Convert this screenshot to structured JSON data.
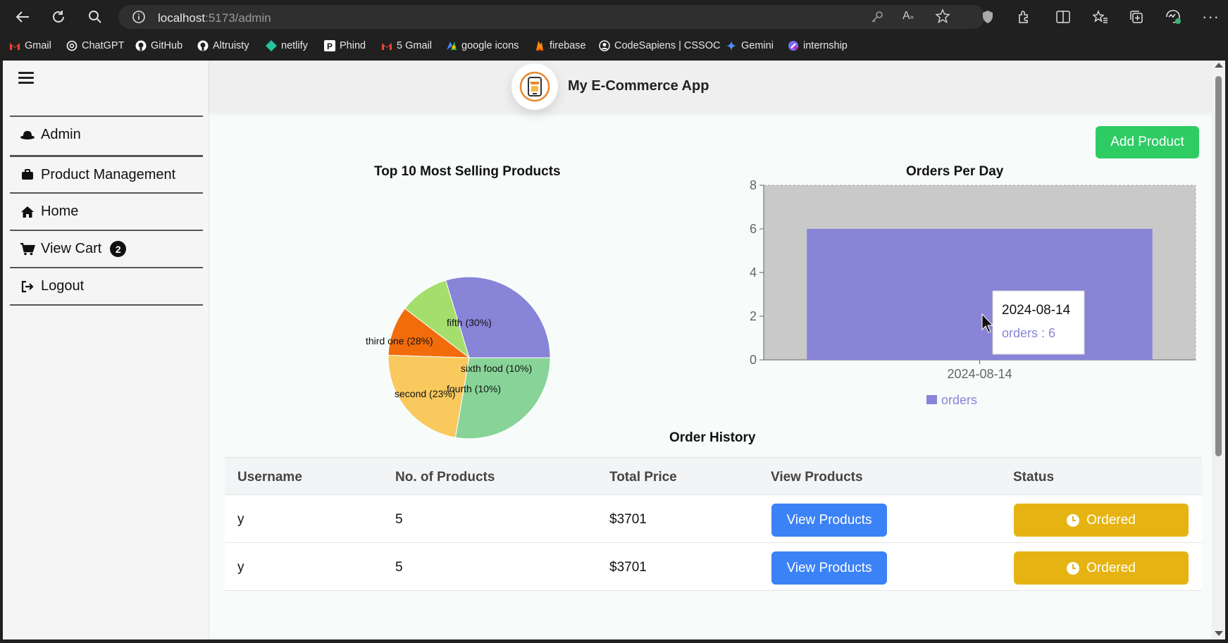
{
  "browser": {
    "url_host": "localhost",
    "url_path": ":5173/admin",
    "bookmarks": [
      {
        "label": "Gmail",
        "icon": "gmail-icon",
        "color": "#ea4335"
      },
      {
        "label": "ChatGPT",
        "icon": "chatgpt-icon",
        "color": "#ffffff"
      },
      {
        "label": "GitHub",
        "icon": "github-icon",
        "color": "#ffffff"
      },
      {
        "label": "Altruisty",
        "icon": "github-icon",
        "color": "#ffffff"
      },
      {
        "label": "netlify",
        "icon": "netlify-icon",
        "color": "#25c2a0"
      },
      {
        "label": "Phind",
        "icon": "phind-icon",
        "color": "#ffffff"
      },
      {
        "label": "5 Gmail",
        "icon": "gmail-icon",
        "color": "#ea4335"
      },
      {
        "label": "google icons",
        "icon": "google-icons-icon",
        "color": "#4285f4"
      },
      {
        "label": "firebase",
        "icon": "firebase-icon",
        "color": "#ff8a00"
      },
      {
        "label": "CodeSapiens | CSSOC",
        "icon": "codesapiens-icon",
        "color": "#ffffff"
      },
      {
        "label": "Gemini",
        "icon": "gemini-icon",
        "color": "#4f8df7"
      },
      {
        "label": "internship",
        "icon": "internship-icon",
        "color": "#7a6cf0"
      }
    ]
  },
  "sidebar": {
    "items": [
      {
        "label": "Admin",
        "icon": "admin-hat-icon"
      },
      {
        "label": "Product Management",
        "icon": "briefcase-icon"
      },
      {
        "label": "Home",
        "icon": "home-icon"
      },
      {
        "label": "View Cart",
        "icon": "cart-icon",
        "badge": "2"
      },
      {
        "label": "Logout",
        "icon": "logout-icon"
      }
    ]
  },
  "header": {
    "title": "My E-Commerce App"
  },
  "actions": {
    "add_product": "Add Product"
  },
  "chart_data": [
    {
      "type": "pie",
      "title": "Top 10 Most Selling Products",
      "slices": [
        {
          "label": "fifth (30%)",
          "value": 30,
          "color": "#8884d8"
        },
        {
          "label": "sixth food (10%)",
          "value": 10,
          "color": "#a4de6c"
        },
        {
          "label": "fourth (10%)",
          "value": 10,
          "color": "#f26c0c"
        },
        {
          "label": "second (23%)",
          "value": 23,
          "color": "#f9c95e"
        },
        {
          "label": "third one (28%)",
          "value": 28,
          "color": "#88d498"
        }
      ]
    },
    {
      "type": "bar",
      "title": "Orders Per Day",
      "categories": [
        "2024-08-14"
      ],
      "series": [
        {
          "name": "orders",
          "values": [
            6
          ],
          "color": "#8884d8"
        }
      ],
      "ylim": [
        0,
        8
      ],
      "yticks": [
        "0",
        "2",
        "4",
        "6",
        "8"
      ],
      "tooltip": {
        "date": "2024-08-14",
        "text": "orders : 6"
      }
    }
  ],
  "orders": {
    "title": "Order History",
    "columns": [
      "Username",
      "No. of Products",
      "Total Price",
      "View Products",
      "Status"
    ],
    "rows": [
      {
        "username": "y",
        "count": "5",
        "total": "$3701",
        "view": "View Products",
        "status": "Ordered"
      },
      {
        "username": "y",
        "count": "5",
        "total": "$3701",
        "view": "View Products",
        "status": "Ordered"
      }
    ]
  }
}
